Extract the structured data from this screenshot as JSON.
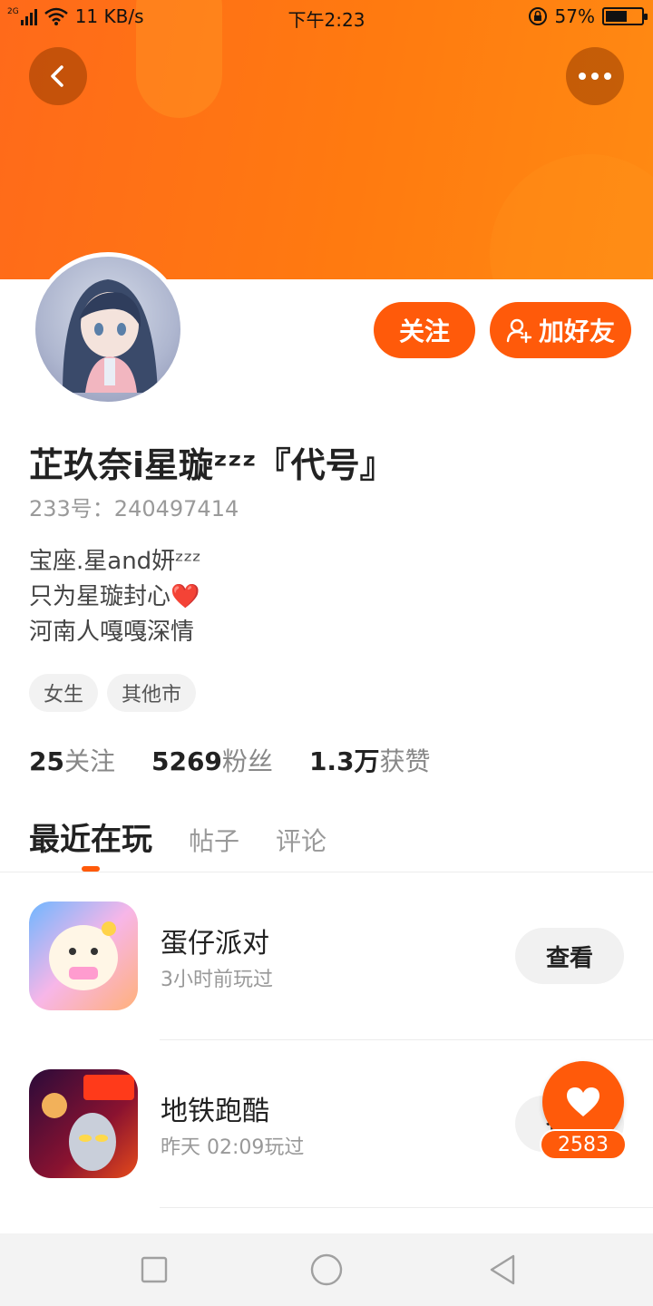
{
  "statusbar": {
    "network": "2G",
    "speed": "11 KB/s",
    "time": "下午2:23",
    "battery": "57%",
    "battery_level": 0.57
  },
  "profile": {
    "name": "芷玖奈i星璇ᶻᶻᶻ『代号』",
    "uid": "233号：240497414",
    "bio": [
      "宝座.星and妍ᶻᶻᶻ",
      "只为星璇封心❤️",
      "河南人嘎嘎深情"
    ],
    "tags": [
      "女生",
      "其他市"
    ],
    "follow_label": "关注",
    "add_friend_label": "加好友"
  },
  "stats": [
    {
      "num": "25",
      "label": "关注"
    },
    {
      "num": "5269",
      "label": "粉丝"
    },
    {
      "num": "1.3万",
      "label": "获赞"
    }
  ],
  "tabs": [
    {
      "label": "最近在玩",
      "active": true
    },
    {
      "label": "帖子",
      "active": false
    },
    {
      "label": "评论",
      "active": false
    }
  ],
  "games": [
    {
      "name": "蛋仔派对",
      "time": "3小时前玩过",
      "button": "查看"
    },
    {
      "name": "地铁跑酷",
      "time": "昨天 02:09玩过",
      "button": "查看"
    }
  ],
  "like": {
    "count": "2583"
  },
  "colors": {
    "accent": "#ff5a0a",
    "header": "#ff7a10"
  },
  "icons": [
    "back-arrow-icon",
    "more-icon",
    "add-user-icon",
    "heart-icon",
    "square-icon",
    "circle-icon",
    "triangle-back-icon"
  ]
}
